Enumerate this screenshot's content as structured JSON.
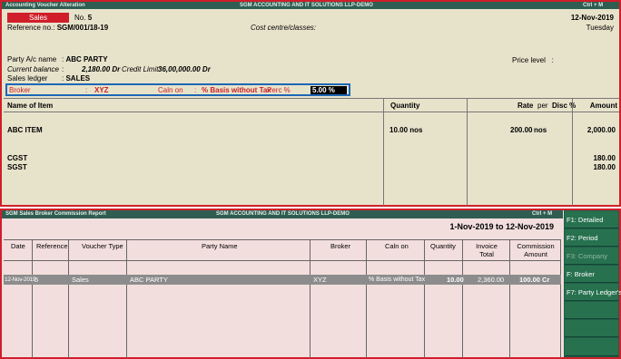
{
  "voucher": {
    "titlebar": {
      "left": "Accounting Voucher Alteration",
      "center": "SGM ACCOUNTING AND IT SOLUTIONS LLP-DEMO",
      "right": "Ctrl + M"
    },
    "type_badge": "Sales",
    "no_label": "No.",
    "no_value": "5",
    "date": "12-Nov-2019",
    "day": "Tuesday",
    "reference_label": "Reference no.:",
    "reference_value": "SGM/001/18-19",
    "cost_centre": "Cost centre/classes:",
    "party_label": "Party A/c name",
    "party_value": "ABC PARTY",
    "current_balance_label": "Current balance",
    "current_balance_value": "2,180.00 Dr",
    "credit_limit_label": "Credit Limit:",
    "credit_limit_value": "36,00,000.00 Dr",
    "sales_ledger_label": "Sales ledger",
    "sales_ledger_value": "SALES",
    "price_level_label": "Price level",
    "broker_label": "Broker",
    "broker_value": "XYZ",
    "calc_on_label": "Caln on",
    "calc_on_value": "% Basis without Tax",
    "perc_label": "Perc %",
    "perc_value": "5.00 %",
    "headers": {
      "name": "Name of Item",
      "quantity": "Quantity",
      "rate": "Rate",
      "per": "per",
      "disc": "Disc %",
      "amount": "Amount"
    },
    "item": {
      "name": "ABC ITEM",
      "quantity": "10.00 nos",
      "rate": "200.00",
      "per": "nos",
      "amount": "2,000.00"
    },
    "taxes": [
      {
        "name": "CGST",
        "amount": "180.00"
      },
      {
        "name": "SGST",
        "amount": "180.00"
      }
    ]
  },
  "report": {
    "titlebar": {
      "left": "SGM Sales Broker Commission Report",
      "center": "SGM ACCOUNTING AND IT SOLUTIONS LLP-DEMO",
      "right": "Ctrl + M"
    },
    "period": "1-Nov-2019 to 12-Nov-2019",
    "columns": {
      "date": "Date",
      "reference": "Reference",
      "voucher_type": "Voucher Type",
      "party_name": "Party Name",
      "broker": "Broker",
      "calc_on": "Caln on",
      "quantity": "Quantity",
      "invoice_total_1": "Invoice",
      "invoice_total_2": "Total",
      "commission_1": "Commission",
      "commission_2": "Amount"
    },
    "row": {
      "date": "12-Nov-2019",
      "reference": "5",
      "voucher_type": "Sales",
      "party_name": "ABC PARTY",
      "broker": "XYZ",
      "calc_on": "% Basis without Tax",
      "quantity": "10.00",
      "invoice_total": "2,360.00",
      "commission": "100.00 Cr"
    }
  },
  "side_buttons": [
    {
      "label": "F1: Detailed",
      "enabled": true
    },
    {
      "label": "F2: Period",
      "enabled": true
    },
    {
      "label": "F3: Company",
      "enabled": false
    },
    {
      "label": "F: Broker",
      "enabled": true
    },
    {
      "label": "F7: Party Ledger's",
      "enabled": true
    }
  ],
  "colors": {
    "titlebar": "#2f5d52",
    "voucher_bg": "#e7e3cb",
    "report_bg": "#f3dede",
    "highlight_border": "#1d67b5",
    "accent_red": "#d01f2a"
  }
}
